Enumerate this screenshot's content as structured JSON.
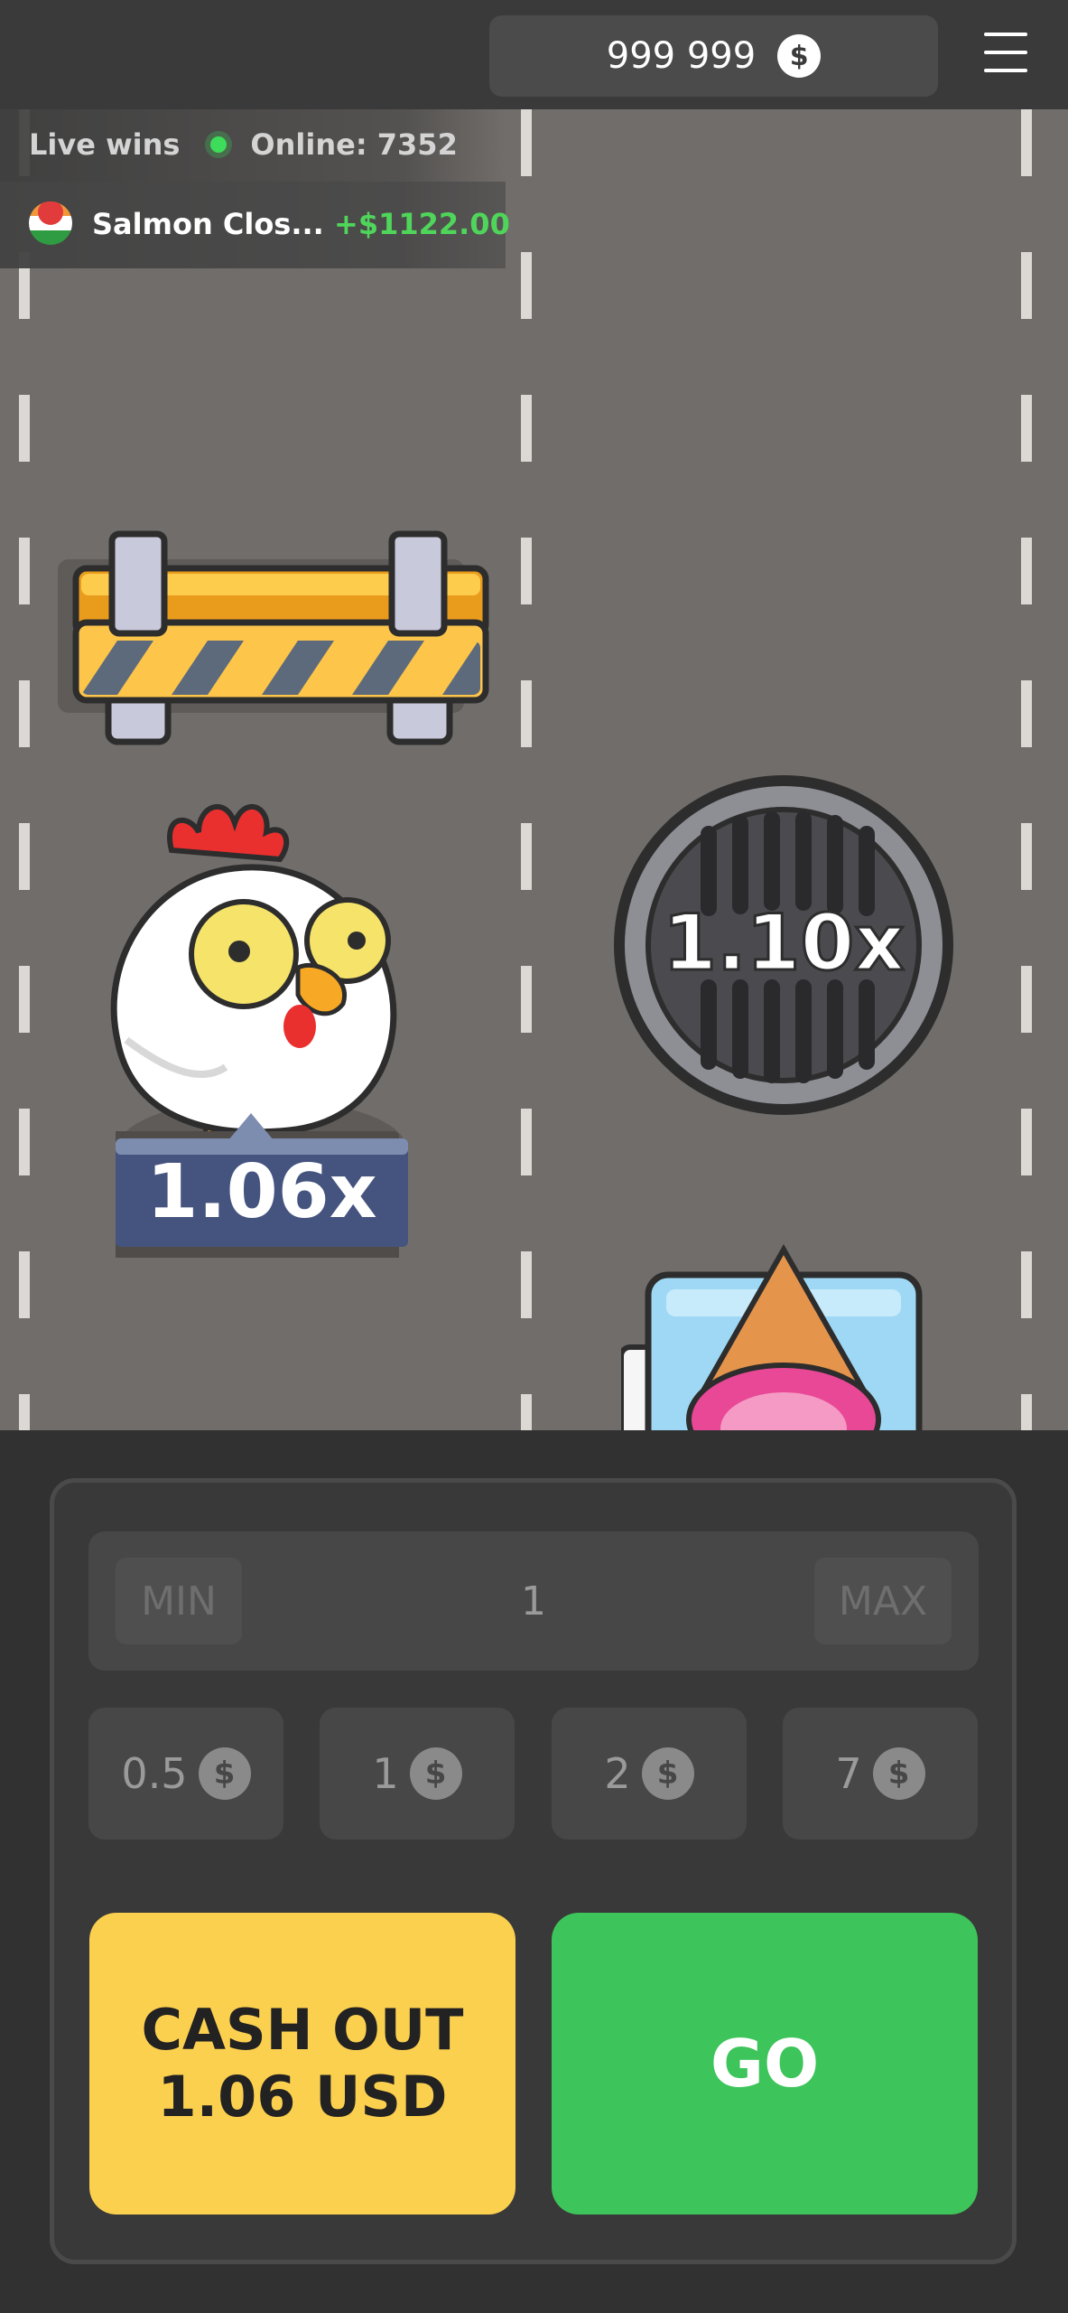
{
  "header": {
    "balance": "999 999",
    "currency_symbol": "$",
    "menu_icon": "hamburger-menu-icon"
  },
  "live_wins": {
    "label": "Live wins",
    "online": "Online: 7352",
    "entries": [
      {
        "name": "Salmon Clos...",
        "amount": "+$1122.00"
      }
    ]
  },
  "game": {
    "current_multiplier": "1.06x",
    "next_multiplier": "1.10x"
  },
  "bet": {
    "min_label": "MIN",
    "max_label": "MAX",
    "value": "1",
    "chips": [
      {
        "label": "0.5",
        "symbol": "$"
      },
      {
        "label": "1",
        "symbol": "$"
      },
      {
        "label": "2",
        "symbol": "$"
      },
      {
        "label": "7",
        "symbol": "$"
      }
    ]
  },
  "actions": {
    "cashout_line1": "CASH OUT",
    "cashout_line2": "1.06 USD",
    "go_label": "GO"
  },
  "colors": {
    "cashout": "#fcd04f",
    "go": "#3dc45a",
    "win_amount": "#4fd65a",
    "road": "#716d6a"
  }
}
